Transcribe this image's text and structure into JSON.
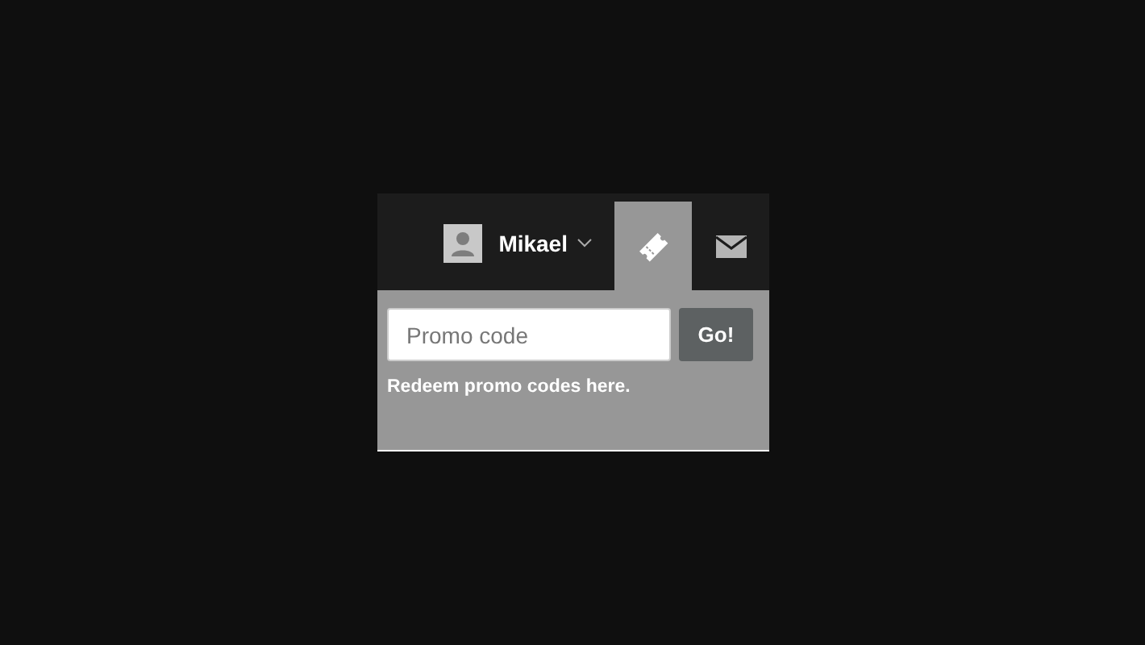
{
  "account_bar": {
    "user": {
      "name": "Mikael"
    },
    "tabs": [
      {
        "kind": "promo",
        "selected": true
      },
      {
        "kind": "messages",
        "selected": false
      }
    ]
  },
  "promo_panel": {
    "field": {
      "placeholder": "Promo code"
    },
    "button": "Go!",
    "hint": "Redeem promo codes here."
  }
}
